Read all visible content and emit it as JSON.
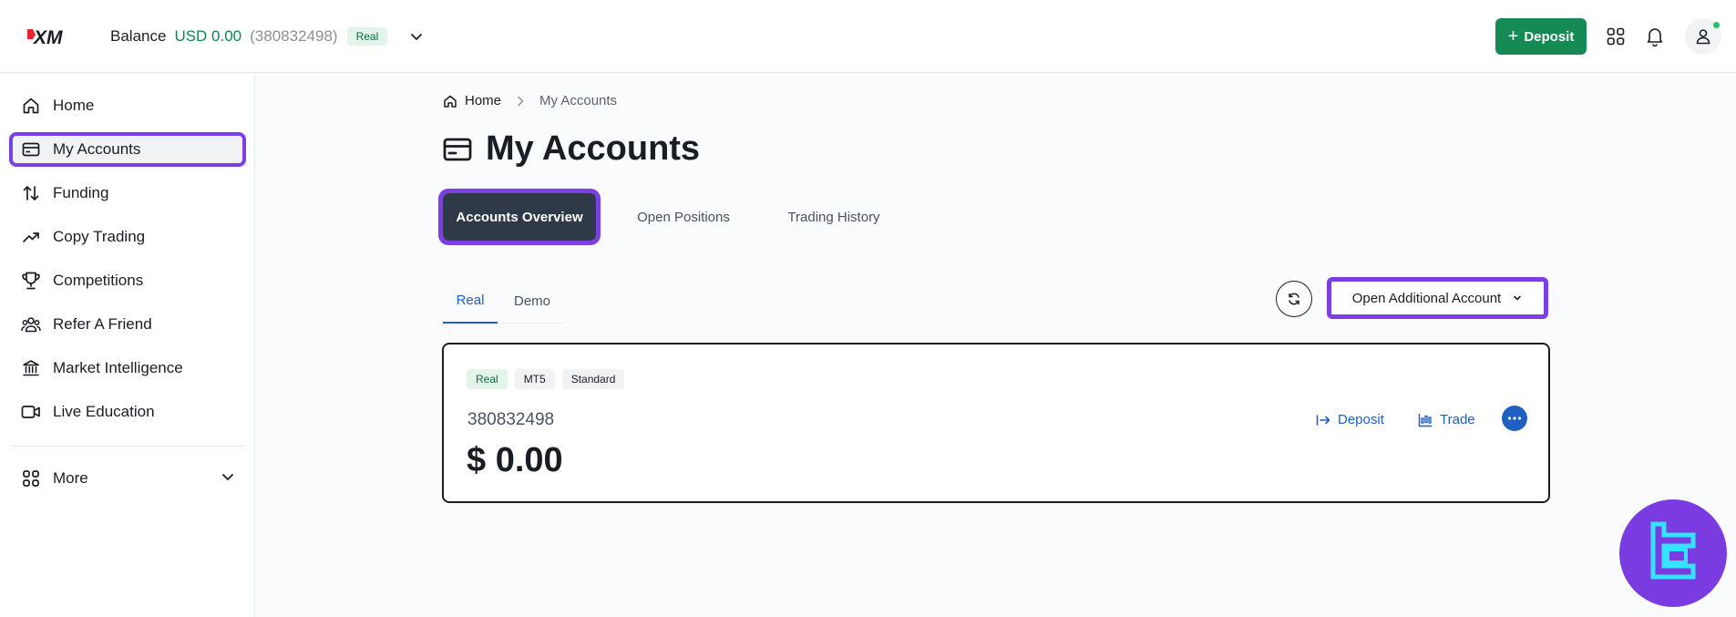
{
  "header": {
    "logo_text": "XM",
    "balance_label": "Balance",
    "balance_amount": "USD 0.00",
    "balance_account": "(380832498)",
    "balance_badge": "Real",
    "deposit_label": "Deposit",
    "icons": [
      "apps-grid-icon",
      "bell-icon",
      "user-icon"
    ]
  },
  "sidebar": {
    "items": [
      {
        "label": "Home",
        "icon": "home-icon"
      },
      {
        "label": "My Accounts",
        "icon": "card-icon",
        "active": true
      },
      {
        "label": "Funding",
        "icon": "transfer-arrows-icon"
      },
      {
        "label": "Copy Trading",
        "icon": "trend-up-icon"
      },
      {
        "label": "Competitions",
        "icon": "trophy-icon"
      },
      {
        "label": "Refer A Friend",
        "icon": "users-icon"
      },
      {
        "label": "Market Intelligence",
        "icon": "bank-icon"
      },
      {
        "label": "Live Education",
        "icon": "video-icon"
      }
    ],
    "more_label": "More"
  },
  "breadcrumb": {
    "home": "Home",
    "current": "My Accounts"
  },
  "page_title": "My Accounts",
  "top_tabs": [
    "Accounts Overview",
    "Open Positions",
    "Trading History"
  ],
  "sub_tabs": [
    "Real",
    "Demo"
  ],
  "open_account_label": "Open Additional Account",
  "account_card": {
    "chips": [
      "Real",
      "MT5",
      "Standard"
    ],
    "number": "380832498",
    "balance": "$ 0.00",
    "deposit_label": "Deposit",
    "trade_label": "Trade"
  },
  "colors": {
    "brand_green": "#168a55",
    "highlight_purple": "#7b3fe4",
    "link_blue": "#1f5fbf",
    "active_tab": "#2f3a48"
  }
}
